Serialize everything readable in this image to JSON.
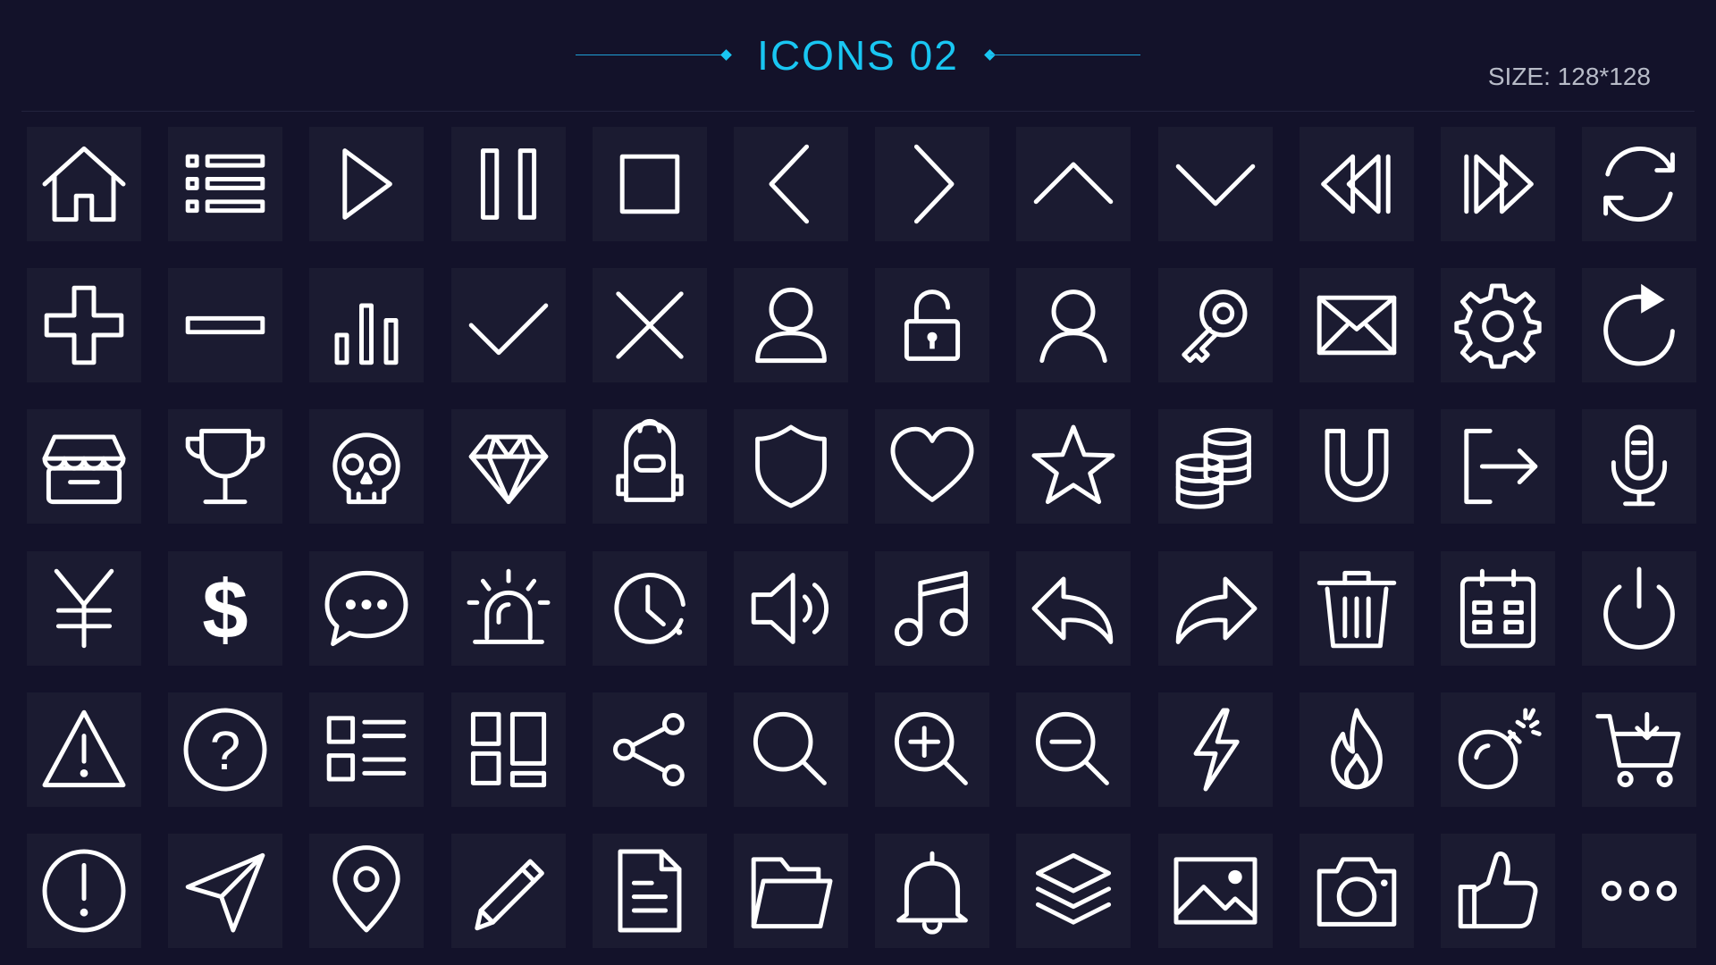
{
  "header": {
    "title": "ICONS 02",
    "size_label": "SIZE: 128*128"
  },
  "colors": {
    "background": "#13122a",
    "tile": "#1b1b31",
    "accent": "#19c6f2",
    "icon_stroke": "#ffffff",
    "size_text": "#b8bcc8"
  },
  "icons": [
    [
      "home-icon",
      "list-icon",
      "play-icon",
      "pause-icon",
      "stop-icon",
      "chevron-left-icon",
      "chevron-right-icon",
      "chevron-up-icon",
      "chevron-down-icon",
      "rewind-icon",
      "fast-forward-icon",
      "refresh-icon"
    ],
    [
      "plus-icon",
      "minus-icon",
      "bar-chart-icon",
      "check-icon",
      "close-icon",
      "user-icon",
      "lock-icon",
      "user-outline-icon",
      "key-icon",
      "mail-icon",
      "gear-icon",
      "redo-icon"
    ],
    [
      "store-icon",
      "trophy-icon",
      "skull-icon",
      "diamond-icon",
      "backpack-icon",
      "shield-icon",
      "heart-icon",
      "star-icon",
      "coins-icon",
      "magnet-icon",
      "logout-icon",
      "microphone-icon"
    ],
    [
      "yen-icon",
      "dollar-icon",
      "chat-icon",
      "alarm-icon",
      "clock-icon",
      "volume-icon",
      "music-icon",
      "reply-icon",
      "forward-icon",
      "trash-icon",
      "calendar-icon",
      "power-icon"
    ],
    [
      "warning-icon",
      "help-icon",
      "list-view-icon",
      "grid-view-icon",
      "share-icon",
      "search-icon",
      "zoom-in-icon",
      "zoom-out-icon",
      "lightning-icon",
      "fire-icon",
      "bomb-icon",
      "cart-icon"
    ],
    [
      "exclamation-icon",
      "navigation-icon",
      "location-pin-icon",
      "pencil-icon",
      "document-icon",
      "folder-icon",
      "bell-icon",
      "layers-icon",
      "image-icon",
      "camera-icon",
      "thumbs-up-icon",
      "more-icon"
    ]
  ]
}
